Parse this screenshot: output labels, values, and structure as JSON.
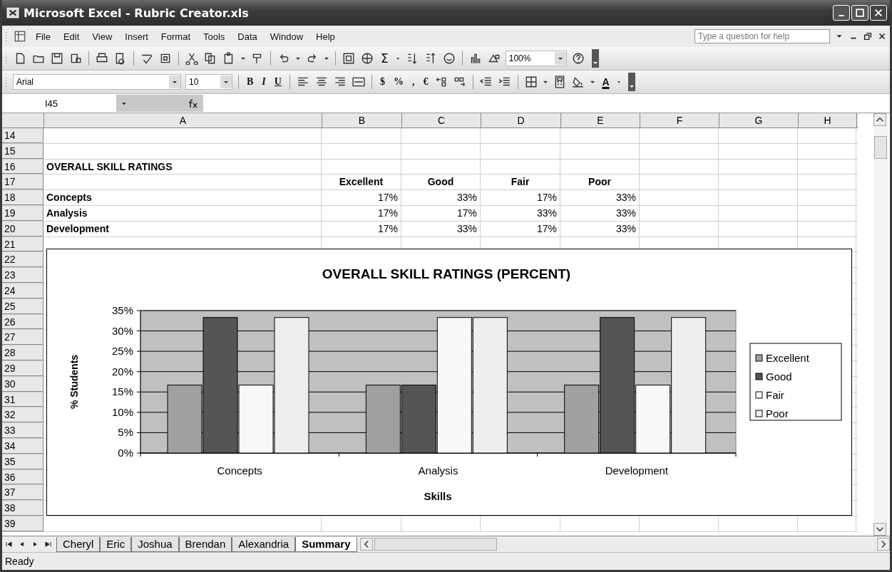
{
  "window": {
    "title": "Microsoft Excel - Rubric Creator.xls"
  },
  "menu": [
    {
      "label": "File"
    },
    {
      "label": "Edit"
    },
    {
      "label": "View"
    },
    {
      "label": "Insert"
    },
    {
      "label": "Format"
    },
    {
      "label": "Tools"
    },
    {
      "label": "Data"
    },
    {
      "label": "Window"
    },
    {
      "label": "Help"
    }
  ],
  "help_box": {
    "placeholder": "Type a question for help"
  },
  "standard_toolbar": {
    "sum": "Σ",
    "zoom": "100%"
  },
  "formatting_toolbar": {
    "font": "Arial",
    "size": "10",
    "bold": "B",
    "italic": "I",
    "underline": "U",
    "currency": "$",
    "percent": "%",
    "comma": ",",
    "euro": "€",
    "font_color": "A"
  },
  "name_box": "I45",
  "columns": [
    "A",
    "B",
    "C",
    "D",
    "E",
    "F",
    "G",
    "H"
  ],
  "rows": [
    {
      "number": "14",
      "kind": "blank"
    },
    {
      "number": "15",
      "kind": "blank"
    },
    {
      "number": "16",
      "kind": "title",
      "label": "OVERALL SKILL RATINGS"
    },
    {
      "number": "17",
      "kind": "header",
      "cells": [
        "Excellent",
        "Good",
        "Fair",
        "Poor"
      ]
    },
    {
      "number": "18",
      "kind": "data",
      "label": "Concepts",
      "cells": [
        "17%",
        "33%",
        "17%",
        "33%"
      ]
    },
    {
      "number": "19",
      "kind": "data",
      "label": "Analysis",
      "cells": [
        "17%",
        "17%",
        "33%",
        "33%"
      ]
    },
    {
      "number": "20",
      "kind": "data",
      "label": "Development",
      "cells": [
        "17%",
        "33%",
        "17%",
        "33%"
      ]
    },
    {
      "number": "21",
      "kind": "blank"
    },
    {
      "number": "22",
      "kind": "blank"
    },
    {
      "number": "23",
      "kind": "blank"
    },
    {
      "number": "24",
      "kind": "blank"
    },
    {
      "number": "25",
      "kind": "blank"
    },
    {
      "number": "26",
      "kind": "blank"
    },
    {
      "number": "27",
      "kind": "blank"
    },
    {
      "number": "28",
      "kind": "blank"
    },
    {
      "number": "29",
      "kind": "blank"
    },
    {
      "number": "30",
      "kind": "blank"
    },
    {
      "number": "31",
      "kind": "blank"
    },
    {
      "number": "32",
      "kind": "blank"
    },
    {
      "number": "33",
      "kind": "blank"
    },
    {
      "number": "34",
      "kind": "blank"
    },
    {
      "number": "35",
      "kind": "blank"
    },
    {
      "number": "36",
      "kind": "blank"
    },
    {
      "number": "37",
      "kind": "blank"
    },
    {
      "number": "38",
      "kind": "blank"
    },
    {
      "number": "39",
      "kind": "blank"
    }
  ],
  "chart": {
    "chart_data": {
      "type": "bar",
      "title": "OVERALL SKILL RATINGS (PERCENT)",
      "xlabel": "Skills",
      "ylabel": "% Students",
      "categories": [
        "Concepts",
        "Analysis",
        "Development"
      ],
      "series": [
        {
          "name": "Excellent",
          "color": "#a0a0a0",
          "values": [
            16.7,
            16.7,
            16.7
          ]
        },
        {
          "name": "Good",
          "color": "#555555",
          "values": [
            33.3,
            16.7,
            33.3
          ]
        },
        {
          "name": "Fair",
          "color": "#f8f8f8",
          "values": [
            16.7,
            33.3,
            16.7
          ]
        },
        {
          "name": "Poor",
          "color": "#eeeeee",
          "values": [
            33.3,
            33.3,
            33.3
          ]
        }
      ],
      "grid": true,
      "legend": true,
      "ylim": [
        0,
        35
      ],
      "yticks": [
        {
          "value": 0,
          "label": "0%"
        },
        {
          "value": 5,
          "label": "5%"
        },
        {
          "value": 10,
          "label": "10%"
        },
        {
          "value": 15,
          "label": "15%"
        },
        {
          "value": 20,
          "label": "20%"
        },
        {
          "value": 25,
          "label": "25%"
        },
        {
          "value": 30,
          "label": "30%"
        },
        {
          "value": 35,
          "label": "35%"
        }
      ]
    }
  },
  "sheet_tabs": [
    {
      "label": "Cheryl",
      "selected": false
    },
    {
      "label": "Eric",
      "selected": false
    },
    {
      "label": "Joshua",
      "selected": false
    },
    {
      "label": "Brendan",
      "selected": false
    },
    {
      "label": "Alexandria",
      "selected": false
    },
    {
      "label": "Summary",
      "selected": true
    }
  ],
  "status_bar": {
    "text": "Ready"
  }
}
